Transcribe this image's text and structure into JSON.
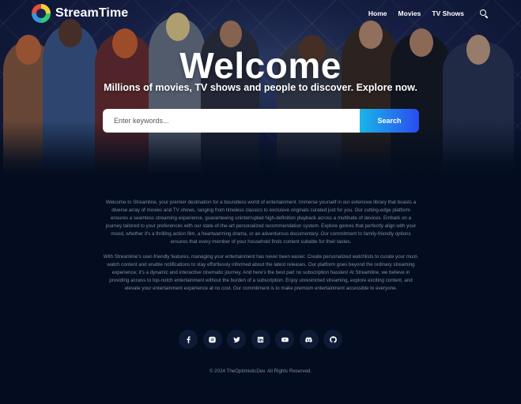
{
  "nav": {
    "brand": "StreamTime",
    "links": [
      "Home",
      "Movies",
      "TV Shows"
    ]
  },
  "hero": {
    "title": "Welcome",
    "subtitle": "Millions of movies, TV shows and people to discover. Explore now.",
    "search_placeholder": "Enter keywords...",
    "search_button": "Search"
  },
  "about": {
    "paragraph1": "Welcome to Streamline, your premier destination for a boundless world of entertainment. Immerse yourself in our extensive library that boasts a diverse array of movies and TV shows, ranging from timeless classics to exclusive originals curated just for you. Our cutting-edge platform ensures a seamless streaming experience, guaranteeing uninterrupted high-definition playback across a multitude of devices. Embark on a journey tailored to your preferences with our state-of-the-art personalized recommendation system. Explore genres that perfectly align with your mood, whether it's a thrilling action film, a heartwarming drama, or an adventurous documentary. Our commitment to family-friendly options ensures that every member of your household finds content suitable for their tastes.",
    "paragraph2": "With Streamline's user-friendly features, managing your entertainment has never been easier. Create personalized watchlists to curate your must-watch content and enable notifications to stay effortlessly informed about the latest releases. Our platform goes beyond the ordinary streaming experience; it's a dynamic and interactive cinematic journey. And here's the best part no subscription hassles! At Streamline, we believe in providing access to top-notch entertainment without the burden of a subscription. Enjoy unrestricted streaming, explore exciting content, and elevate your entertainment experience at no cost. Our commitment is to make premium entertainment accessible to everyone."
  },
  "social": [
    "facebook-icon",
    "instagram-icon",
    "twitter-icon",
    "linkedin-icon",
    "youtube-icon",
    "discord-icon",
    "github-icon"
  ],
  "footer": {
    "copyright": "© 2024 TheOptimisticDev. All Rights Reserved."
  },
  "colors": {
    "background": "#030d1f",
    "search_button_start": "#19b6e6",
    "search_button_end": "#2a4bf0",
    "social_bg": "#0f1a36",
    "muted_text": "#7f8aa3"
  }
}
